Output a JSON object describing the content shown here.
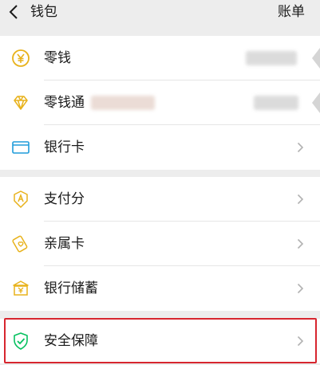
{
  "header": {
    "title": "钱包",
    "right_link": "账单"
  },
  "group1": {
    "items": [
      {
        "label": "零钱",
        "icon": "coin-yuan-icon"
      },
      {
        "label": "零钱通",
        "icon": "diamond-icon"
      },
      {
        "label": "银行卡",
        "icon": "bank-card-icon"
      }
    ]
  },
  "group2": {
    "items": [
      {
        "label": "支付分",
        "icon": "pay-score-icon"
      },
      {
        "label": "亲属卡",
        "icon": "family-card-icon"
      },
      {
        "label": "银行储蓄",
        "icon": "bank-savings-icon"
      }
    ]
  },
  "group3": {
    "items": [
      {
        "label": "安全保障",
        "icon": "shield-check-icon"
      }
    ]
  },
  "colors": {
    "background": "#ededed",
    "icon_yellow": "#e8b21b",
    "icon_blue": "#1f9cda",
    "icon_green": "#07c160",
    "highlight_red": "#d7262f"
  }
}
